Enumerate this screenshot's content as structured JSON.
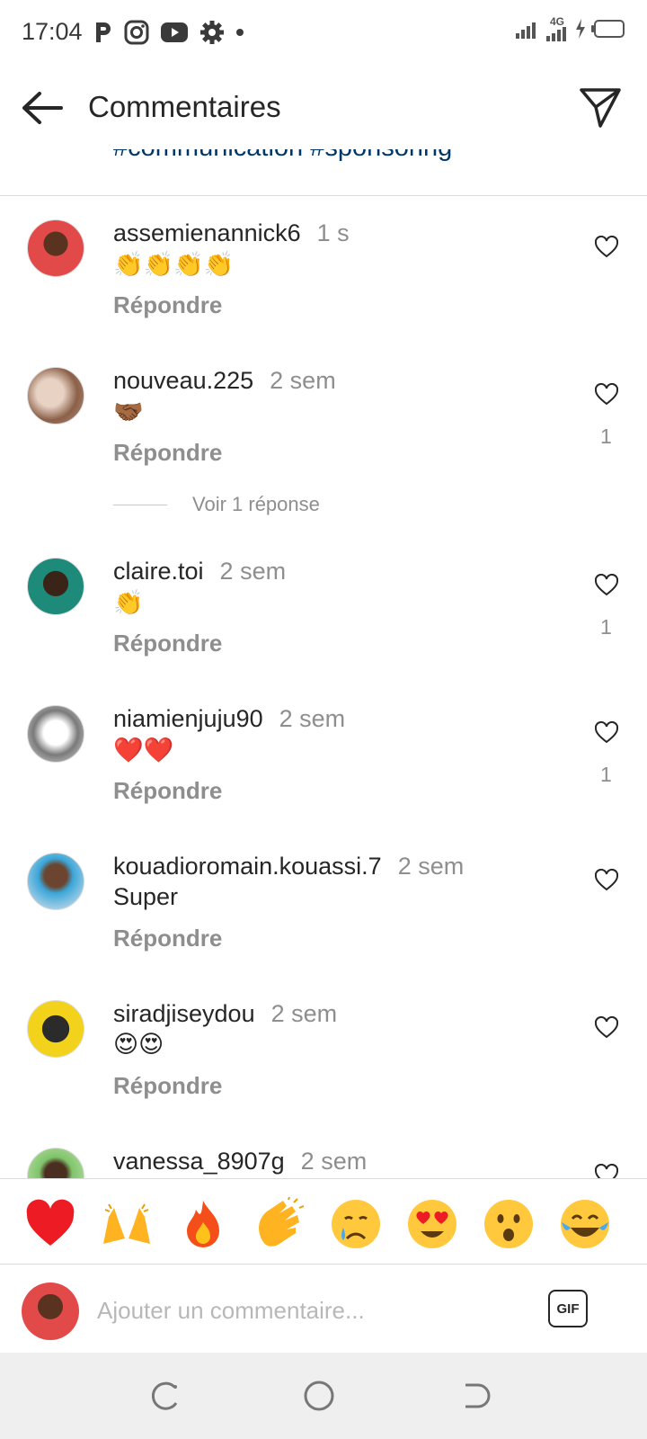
{
  "status_bar": {
    "time": "17:04",
    "notification_icons": [
      "p-icon",
      "instagram-icon",
      "youtube-icon",
      "settings-icon",
      "dot-icon"
    ],
    "network": "4G"
  },
  "header": {
    "title": "Commentaires",
    "caption_fragment": "#communication #sponsoring"
  },
  "comments": [
    {
      "username": "assemienannick6",
      "time": "1 s",
      "text": "👏👏👏👏",
      "reply_label": "Répondre",
      "likes": ""
    },
    {
      "username": "nouveau.225",
      "time": "2 sem",
      "text": "🤝🏾",
      "reply_label": "Répondre",
      "likes": "1"
    },
    {
      "username": "claire.toi",
      "time": "2 sem",
      "text": "👏",
      "reply_label": "Répondre",
      "likes": "1"
    },
    {
      "username": "niamienjuju90",
      "time": "2 sem",
      "text": "❤️❤️",
      "reply_label": "Répondre",
      "likes": "1"
    },
    {
      "username": "kouadioromain.kouassi.7",
      "time": "2 sem",
      "text": "Super",
      "reply_label": "Répondre",
      "likes": ""
    },
    {
      "username": "siradjiseydou",
      "time": "2 sem",
      "text": "😍😍",
      "reply_label": "Répondre",
      "likes": ""
    },
    {
      "username": "vanessa_8907g",
      "time": "2 sem",
      "text": "",
      "reply_label": "",
      "likes": ""
    }
  ],
  "view_replies_label": "Voir 1 réponse",
  "emoji_bar": [
    "❤️",
    "🙌",
    "🔥",
    "👏",
    "😢",
    "😍",
    "😮",
    "😂"
  ],
  "comment_input": {
    "placeholder": "Ajouter un commentaire...",
    "gif_label": "GIF"
  },
  "colors": {
    "link": "#00376b",
    "secondary_text": "#8e8e8e",
    "divider": "#dbdbdb",
    "nav_bg": "#efefef"
  }
}
